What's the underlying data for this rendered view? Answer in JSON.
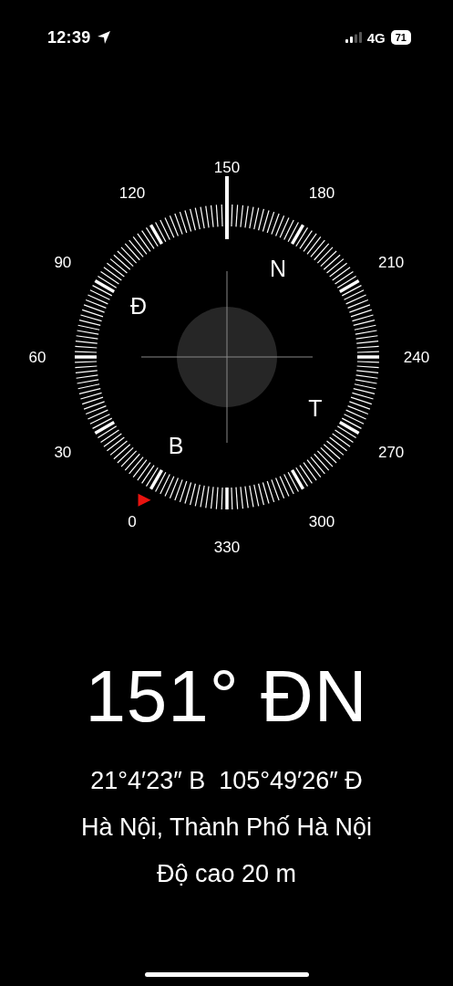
{
  "status_bar": {
    "time": "12:39",
    "network": "4G",
    "battery": "71"
  },
  "dial": {
    "degree_labels": [
      "0",
      "30",
      "60",
      "90",
      "120",
      "150",
      "180",
      "210",
      "240",
      "270",
      "300",
      "330"
    ],
    "cardinals": [
      "B",
      "Đ",
      "N",
      "T"
    ]
  },
  "heading": "151° ĐN",
  "coordinates": "21°4′23″ B  105°49′26″ Đ",
  "place": "Hà Nội, Thành Phố Hà Nội",
  "altitude": "Độ cao 20 m"
}
